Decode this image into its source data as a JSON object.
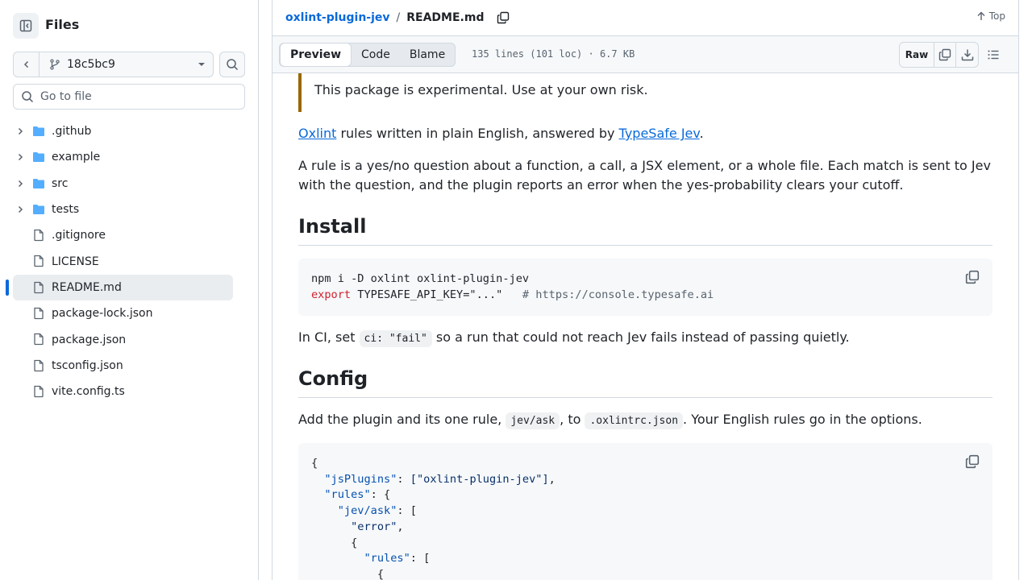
{
  "sidebar": {
    "title": "Files",
    "branch": "18c5bc9",
    "goto_placeholder": "Go to file",
    "items": [
      {
        "label": ".github",
        "type": "folder"
      },
      {
        "label": "example",
        "type": "folder"
      },
      {
        "label": "src",
        "type": "folder"
      },
      {
        "label": "tests",
        "type": "folder"
      },
      {
        "label": ".gitignore",
        "type": "file"
      },
      {
        "label": "LICENSE",
        "type": "file"
      },
      {
        "label": "README.md",
        "type": "file",
        "active": true
      },
      {
        "label": "package-lock.json",
        "type": "file"
      },
      {
        "label": "package.json",
        "type": "file"
      },
      {
        "label": "tsconfig.json",
        "type": "file"
      },
      {
        "label": "vite.config.ts",
        "type": "file"
      }
    ]
  },
  "header": {
    "repo": "oxlint-plugin-jev",
    "separator": "/",
    "file": "README.md",
    "top_label": "Top"
  },
  "toolbar": {
    "tabs": [
      "Preview",
      "Code",
      "Blame"
    ],
    "selected_tab": "Preview",
    "file_info": "135 lines (101 loc) · 6.7 KB",
    "raw_label": "Raw"
  },
  "readme": {
    "callout": "This package is experimental. Use at your own risk.",
    "intro_link1": "Oxlint",
    "intro_mid": " rules written in plain English, answered by ",
    "intro_link2": "TypeSafe Jev",
    "intro_end": ".",
    "para2": "A rule is a yes/no question about a function, a call, a JSX element, or a whole file. Each match is sent to Jev with the question, and the plugin reports an error when the yes-probability clears your cutoff.",
    "h_install": "Install",
    "install_line1": "npm i -D oxlint oxlint-plugin-jev",
    "install_kw": "export",
    "install_line2": " TYPESAFE_API_KEY=\"...\"   ",
    "install_comment": "# https://console.typesafe.ai",
    "ci_before": "In CI, set ",
    "ci_code": "ci: \"fail\"",
    "ci_after": " so a run that could not reach Jev fails instead of passing quietly.",
    "h_config": "Config",
    "config_before": "Add the plugin and its one rule, ",
    "config_code1": "jev/ask",
    "config_mid": ", to ",
    "config_code2": ".oxlintrc.json",
    "config_after": ". Your English rules go in the options.",
    "json_l1": "{",
    "json_k1": "\"jsPlugins\"",
    "json_v1": "[\"oxlint-plugin-jev\"]",
    "json_k2": "\"rules\"",
    "json_k3": "\"jev/ask\"",
    "json_v4": "\"error\"",
    "json_l5": "{",
    "json_k6": "\"rules\"",
    "json_l7": "{"
  },
  "colors": {
    "accent": "#0969da",
    "callout_border": "#9a6700",
    "keyword": "#cf222e"
  }
}
